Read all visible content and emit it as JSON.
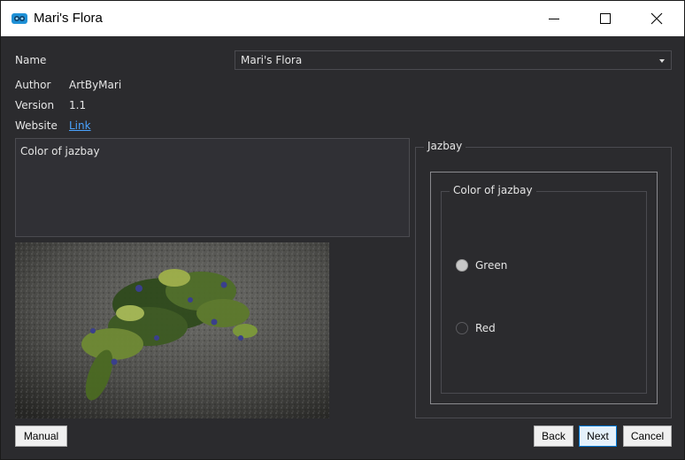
{
  "window": {
    "title": "Mari's Flora"
  },
  "fields": {
    "name_label": "Name",
    "name_value": "Mari's Flora",
    "author_label": "Author",
    "author_value": "ArtByMari",
    "version_label": "Version",
    "version_value": "1.1",
    "website_label": "Website",
    "website_link": "Link"
  },
  "description": {
    "text": "Color of jazbay"
  },
  "options_group": {
    "title": "Jazbay",
    "inner_title": "Color of jazbay",
    "options": [
      {
        "label": "Green",
        "checked": true
      },
      {
        "label": "Red",
        "checked": false
      }
    ]
  },
  "buttons": {
    "manual": "Manual",
    "back": "Back",
    "next": "Next",
    "cancel": "Cancel"
  },
  "colors": {
    "background": "#2b2b2e",
    "link": "#4aa3ff",
    "titlebar": "#ffffff",
    "focus_border": "#0078d7"
  }
}
